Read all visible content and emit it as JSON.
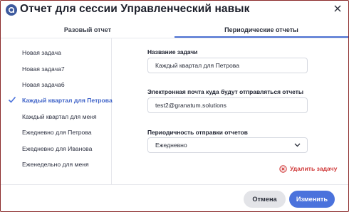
{
  "dialog": {
    "title": "Отчет для сессии Управленческий навык"
  },
  "tabs": [
    {
      "label": "Разовый отчет",
      "active": false
    },
    {
      "label": "Периодические отчеты",
      "active": true
    }
  ],
  "sidebar": {
    "tasks": [
      {
        "label": "Новая задача",
        "active": false
      },
      {
        "label": "Новая задача7",
        "active": false
      },
      {
        "label": "Новая задача6",
        "active": false
      },
      {
        "label": "Каждый квартал для Петрова",
        "active": true
      },
      {
        "label": "Каждый квартал для меня",
        "active": false
      },
      {
        "label": "Ежедневно для Петрова",
        "active": false
      },
      {
        "label": "Ежедневно для Иванова",
        "active": false
      },
      {
        "label": "Еженедельно для меня",
        "active": false
      }
    ]
  },
  "form": {
    "name_label": "Название задачи",
    "name_value": "Каждый квартал для Петрова",
    "email_label": "Электронная почта куда будут отправляться отчеты",
    "email_value": "test2@granatum.solutions",
    "period_label": "Периодичность отправки отчетов",
    "period_value": "Ежедневно",
    "delete_label": "Удалить задачу"
  },
  "footer": {
    "cancel_label": "Отмена",
    "save_label": "Изменить"
  },
  "colors": {
    "accent": "#4a72dc",
    "danger": "#d03a3a",
    "frame_border": "#8a2a2a"
  },
  "icons": {
    "logo": "granatum-logo-icon",
    "close": "close-icon",
    "check": "check-icon",
    "chevron": "chevron-down-icon",
    "delete": "delete-circle-x-icon"
  }
}
